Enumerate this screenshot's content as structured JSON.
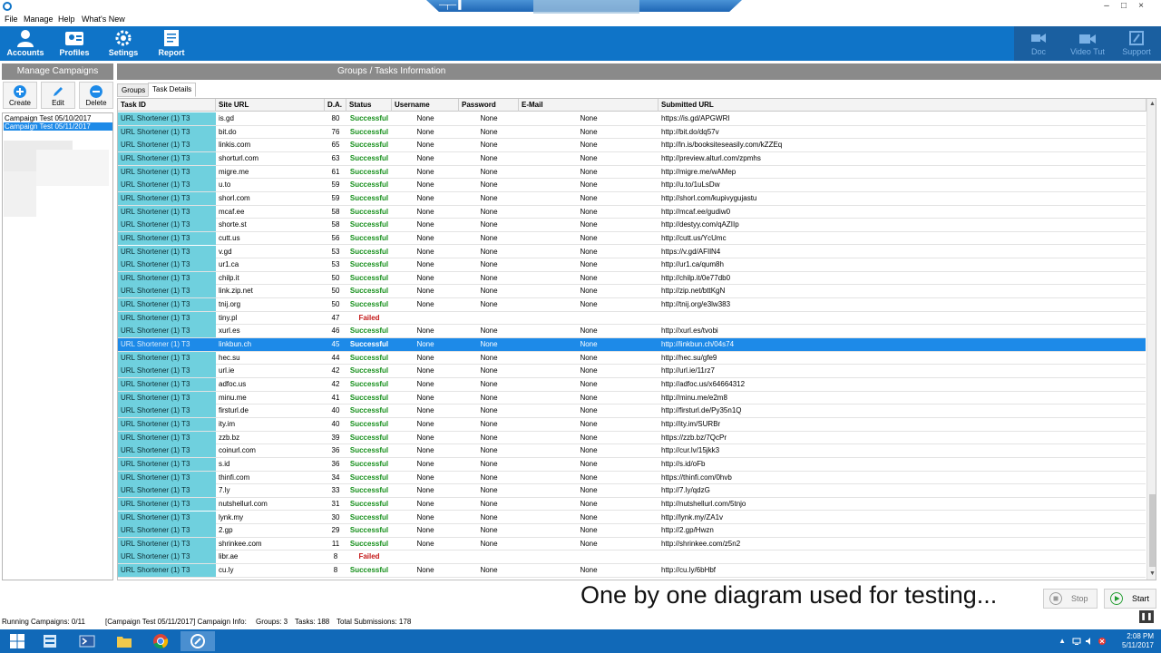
{
  "window": {
    "remote_bar_glyphs": [
      "─┬─",
      "▐"
    ],
    "controls": [
      "–",
      "□",
      "×"
    ]
  },
  "menu": [
    "File",
    "Manage",
    "Help",
    "What's New"
  ],
  "toolbar": {
    "buttons": [
      {
        "label": "Accounts",
        "icon": "accounts-icon"
      },
      {
        "label": "Profiles",
        "icon": "profiles-icon"
      },
      {
        "label": "Setings",
        "icon": "settings-gear-icon"
      },
      {
        "label": "Report",
        "icon": "report-icon"
      }
    ],
    "right_buttons": [
      {
        "label": "Doc",
        "icon": "doc-icon"
      },
      {
        "label": "Video Tut",
        "icon": "video-icon"
      },
      {
        "label": "Support",
        "icon": "support-icon"
      }
    ],
    "colors": {
      "bar": "#0f74c8",
      "right_panel": "#1a5fa0"
    }
  },
  "left_panel": {
    "title": "Manage Campaigns",
    "actions": [
      {
        "label": "Create",
        "icon": "plus-circle-icon",
        "color": "#1d8ae8"
      },
      {
        "label": "Edit",
        "icon": "pencil-icon",
        "color": "#1d8ae8"
      },
      {
        "label": "Delete",
        "icon": "minus-circle-icon",
        "color": "#1d8ae8"
      }
    ],
    "campaigns": [
      {
        "name": "Campaign Test 05/10/2017",
        "selected": false
      },
      {
        "name": "Campaign Test 05/11/2017",
        "selected": true
      }
    ]
  },
  "right_panel": {
    "title": "Groups / Tasks Information",
    "tabs": [
      {
        "label": "Groups",
        "active": false
      },
      {
        "label": "Task Details",
        "active": true
      }
    ]
  },
  "grid": {
    "columns": [
      "Task ID",
      "Site URL",
      "D.A.",
      "Status",
      "Username",
      "Password",
      "E-Mail",
      "Submitted URL"
    ],
    "rows": [
      {
        "task": "URL Shortener (1) T3",
        "site": "is.gd",
        "da": "80",
        "status": "Successful",
        "user": "None",
        "pass": "None",
        "mail": "None",
        "url": "https://is.gd/APGWRI"
      },
      {
        "task": "URL Shortener (1) T3",
        "site": "bit.do",
        "da": "76",
        "status": "Successful",
        "user": "None",
        "pass": "None",
        "mail": "None",
        "url": "http://bit.do/dq57v"
      },
      {
        "task": "URL Shortener (1) T3",
        "site": "linkis.com",
        "da": "65",
        "status": "Successful",
        "user": "None",
        "pass": "None",
        "mail": "None",
        "url": "http://ln.is/booksiteseasily.com/kZZEq"
      },
      {
        "task": "URL Shortener (1) T3",
        "site": "shorturl.com",
        "da": "63",
        "status": "Successful",
        "user": "None",
        "pass": "None",
        "mail": "None",
        "url": "http://preview.alturl.com/zpmhs"
      },
      {
        "task": "URL Shortener (1) T3",
        "site": "migre.me",
        "da": "61",
        "status": "Successful",
        "user": "None",
        "pass": "None",
        "mail": "None",
        "url": "http://migre.me/wAMep"
      },
      {
        "task": "URL Shortener (1) T3",
        "site": "u.to",
        "da": "59",
        "status": "Successful",
        "user": "None",
        "pass": "None",
        "mail": "None",
        "url": "http://u.to/1uLsDw"
      },
      {
        "task": "URL Shortener (1) T3",
        "site": "shorl.com",
        "da": "59",
        "status": "Successful",
        "user": "None",
        "pass": "None",
        "mail": "None",
        "url": "http://shorl.com/kupivygujastu"
      },
      {
        "task": "URL Shortener (1) T3",
        "site": "mcaf.ee",
        "da": "58",
        "status": "Successful",
        "user": "None",
        "pass": "None",
        "mail": "None",
        "url": "http://mcaf.ee/gudiw0"
      },
      {
        "task": "URL Shortener (1) T3",
        "site": "shorte.st",
        "da": "58",
        "status": "Successful",
        "user": "None",
        "pass": "None",
        "mail": "None",
        "url": "http://destyy.com/qAZIIp"
      },
      {
        "task": "URL Shortener (1) T3",
        "site": "cutt.us",
        "da": "56",
        "status": "Successful",
        "user": "None",
        "pass": "None",
        "mail": "None",
        "url": "http://cutt.us/YcUmc"
      },
      {
        "task": "URL Shortener (1) T3",
        "site": "v.gd",
        "da": "53",
        "status": "Successful",
        "user": "None",
        "pass": "None",
        "mail": "None",
        "url": "https://v.gd/AFIlN4"
      },
      {
        "task": "URL Shortener (1) T3",
        "site": "ur1.ca",
        "da": "53",
        "status": "Successful",
        "user": "None",
        "pass": "None",
        "mail": "None",
        "url": "http://ur1.ca/qum8h"
      },
      {
        "task": "URL Shortener (1) T3",
        "site": "chilp.it",
        "da": "50",
        "status": "Successful",
        "user": "None",
        "pass": "None",
        "mail": "None",
        "url": "http://chilp.it/0e77db0"
      },
      {
        "task": "URL Shortener (1) T3",
        "site": "link.zip.net",
        "da": "50",
        "status": "Successful",
        "user": "None",
        "pass": "None",
        "mail": "None",
        "url": "http://zip.net/bttKgN"
      },
      {
        "task": "URL Shortener (1) T3",
        "site": "tnij.org",
        "da": "50",
        "status": "Successful",
        "user": "None",
        "pass": "None",
        "mail": "None",
        "url": "http://tnij.org/e3lw383"
      },
      {
        "task": "URL Shortener (1) T3",
        "site": "tiny.pl",
        "da": "47",
        "status": "Failed",
        "user": "",
        "pass": "",
        "mail": "",
        "url": ""
      },
      {
        "task": "URL Shortener (1) T3",
        "site": "xurl.es",
        "da": "46",
        "status": "Successful",
        "user": "None",
        "pass": "None",
        "mail": "None",
        "url": "http://xurl.es/tvobi"
      },
      {
        "task": "URL Shortener (1) T3",
        "site": "linkbun.ch",
        "da": "45",
        "status": "Successful",
        "user": "None",
        "pass": "None",
        "mail": "None",
        "url": "http://linkbun.ch/04s74",
        "selected": true
      },
      {
        "task": "URL Shortener (1) T3",
        "site": "hec.su",
        "da": "44",
        "status": "Successful",
        "user": "None",
        "pass": "None",
        "mail": "None",
        "url": "http://hec.su/gfe9"
      },
      {
        "task": "URL Shortener (1) T3",
        "site": "url.ie",
        "da": "42",
        "status": "Successful",
        "user": "None",
        "pass": "None",
        "mail": "None",
        "url": "http://url.ie/11rz7"
      },
      {
        "task": "URL Shortener (1) T3",
        "site": "adfoc.us",
        "da": "42",
        "status": "Successful",
        "user": "None",
        "pass": "None",
        "mail": "None",
        "url": "http://adfoc.us/x64664312"
      },
      {
        "task": "URL Shortener (1) T3",
        "site": "minu.me",
        "da": "41",
        "status": "Successful",
        "user": "None",
        "pass": "None",
        "mail": "None",
        "url": "http://minu.me/e2m8"
      },
      {
        "task": "URL Shortener (1) T3",
        "site": "firsturl.de",
        "da": "40",
        "status": "Successful",
        "user": "None",
        "pass": "None",
        "mail": "None",
        "url": "http://firsturl.de/Py35n1Q"
      },
      {
        "task": "URL Shortener (1) T3",
        "site": "ity.im",
        "da": "40",
        "status": "Successful",
        "user": "None",
        "pass": "None",
        "mail": "None",
        "url": "http://ity.im/SURBr"
      },
      {
        "task": "URL Shortener (1) T3",
        "site": "zzb.bz",
        "da": "39",
        "status": "Successful",
        "user": "None",
        "pass": "None",
        "mail": "None",
        "url": "https://zzb.bz/7QcPr"
      },
      {
        "task": "URL Shortener (1) T3",
        "site": "coinurl.com",
        "da": "36",
        "status": "Successful",
        "user": "None",
        "pass": "None",
        "mail": "None",
        "url": "http://cur.lv/15jkk3"
      },
      {
        "task": "URL Shortener (1) T3",
        "site": "s.id",
        "da": "36",
        "status": "Successful",
        "user": "None",
        "pass": "None",
        "mail": "None",
        "url": "http://s.id/oFb"
      },
      {
        "task": "URL Shortener (1) T3",
        "site": "thinfi.com",
        "da": "34",
        "status": "Successful",
        "user": "None",
        "pass": "None",
        "mail": "None",
        "url": "https://thinfi.com/0hvb"
      },
      {
        "task": "URL Shortener (1) T3",
        "site": "7.ly",
        "da": "33",
        "status": "Successful",
        "user": "None",
        "pass": "None",
        "mail": "None",
        "url": "http://7.ly/qdzG"
      },
      {
        "task": "URL Shortener (1) T3",
        "site": "nutshellurl.com",
        "da": "31",
        "status": "Successful",
        "user": "None",
        "pass": "None",
        "mail": "None",
        "url": "http://nutshellurl.com/5tnjo"
      },
      {
        "task": "URL Shortener (1) T3",
        "site": "lynk.my",
        "da": "30",
        "status": "Successful",
        "user": "None",
        "pass": "None",
        "mail": "None",
        "url": "http://lynk.my/ZA1v"
      },
      {
        "task": "URL Shortener (1) T3",
        "site": "2.gp",
        "da": "29",
        "status": "Successful",
        "user": "None",
        "pass": "None",
        "mail": "None",
        "url": "http://2.gp/Hwzn"
      },
      {
        "task": "URL Shortener (1) T3",
        "site": "shrinkee.com",
        "da": "11",
        "status": "Successful",
        "user": "None",
        "pass": "None",
        "mail": "None",
        "url": "http://shrinkee.com/z5n2"
      },
      {
        "task": "URL Shortener (1) T3",
        "site": "libr.ae",
        "da": "8",
        "status": "Failed",
        "user": "",
        "pass": "",
        "mail": "",
        "url": ""
      },
      {
        "task": "URL Shortener (1) T3",
        "site": "cu.ly",
        "da": "8",
        "status": "Successful",
        "user": "None",
        "pass": "None",
        "mail": "None",
        "url": "http://cu.ly/6bHbf"
      }
    ],
    "colors": {
      "task_cell": "#6fd0de",
      "selected": "#1d8ae8",
      "success": "#17901c",
      "failed": "#c41818"
    }
  },
  "caption": "One by one diagram used for testing...",
  "controls": {
    "stop_label": "Stop",
    "start_label": "Start"
  },
  "status": {
    "running": "Running Campaigns: 0/11",
    "info": "[Campaign Test 05/11/2017] Campaign Info:",
    "groups": "Groups: 3",
    "tasks": "Tasks: 188",
    "total": "Total Submissions: 178",
    "pause_glyph": "❚❚"
  },
  "taskbar": {
    "apps": [
      "windows-start-icon",
      "server-manager-icon",
      "powershell-icon",
      "file-explorer-icon",
      "chrome-icon",
      "app-icon"
    ],
    "tray_chevron": "▲",
    "time": "2:08 PM",
    "date": "5/11/2017"
  }
}
